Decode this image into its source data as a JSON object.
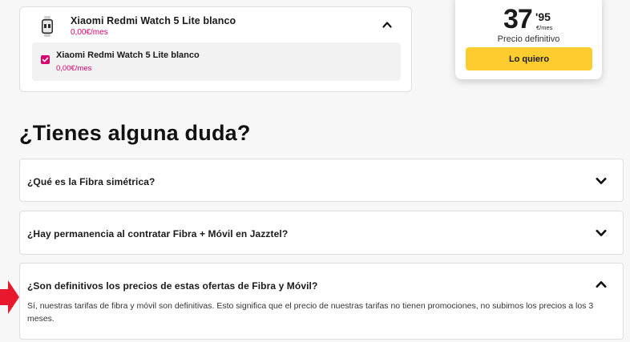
{
  "product": {
    "name": "Xiaomi Redmi Watch 5 Lite blanco",
    "price": "0,00€/mes",
    "option": {
      "name": "Xiaomi Redmi Watch 5 Lite blanco",
      "price": "0,00€/mes",
      "checked": true
    }
  },
  "price_card": {
    "integer": "37",
    "decimals": "'95",
    "unit": "€/mes",
    "label": "Precio definitivo",
    "cta": "Lo quiero"
  },
  "faq": {
    "title": "¿Tienes alguna duda?",
    "items": [
      {
        "question": "¿Qué es la Fibra simétrica?",
        "expanded": false
      },
      {
        "question": "¿Hay permanencia al contratar Fibra + Móvil en Jazztel?",
        "expanded": false
      },
      {
        "question": "¿Son definitivos los precios de estas ofertas de Fibra y Móvil?",
        "expanded": true,
        "answer": "Sí, nuestras tarifas de fibra y móvil son definitivas. Esto significa que el precio de nuestras tarifas no tienen promociones, no subimos los precios a los 3 meses."
      }
    ]
  },
  "colors": {
    "accent_magenta": "#d6006e",
    "cta_yellow": "#fdcd30",
    "annotation_arrow": "#e8192c"
  },
  "icons": [
    "smartwatch-icon",
    "chevron-up-icon",
    "checkmark-icon",
    "chevron-down-icon",
    "red-arrow-icon"
  ]
}
